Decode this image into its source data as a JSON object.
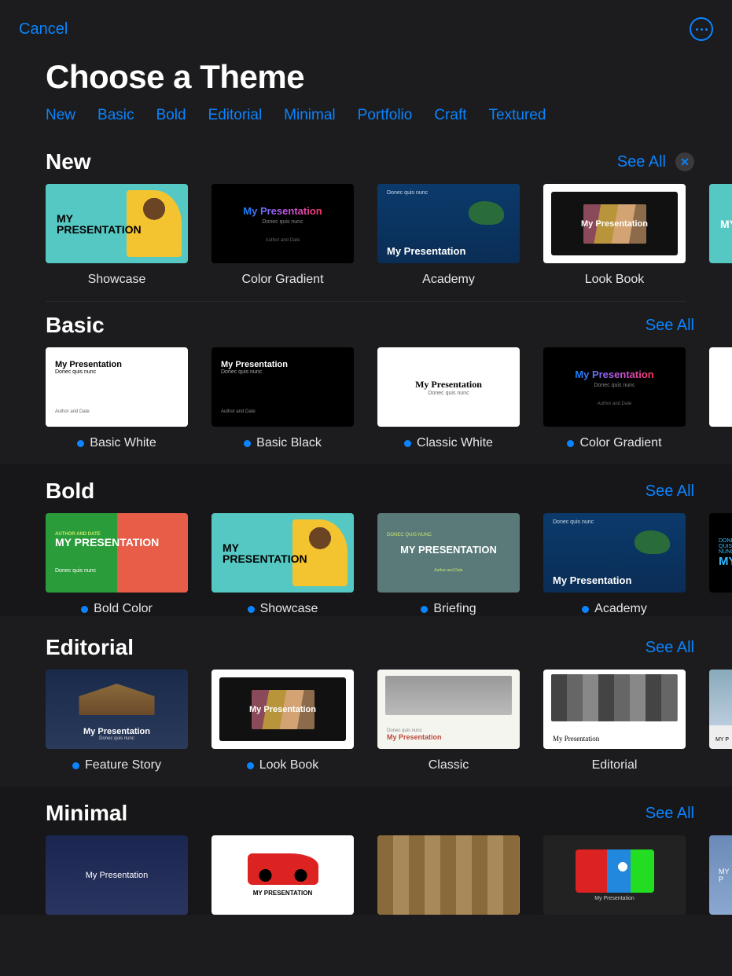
{
  "header": {
    "cancel": "Cancel",
    "title": "Choose a Theme"
  },
  "categories": [
    "New",
    "Basic",
    "Bold",
    "Editorial",
    "Minimal",
    "Portfolio",
    "Craft",
    "Textured"
  ],
  "seeAll": "See All",
  "thumb_text": {
    "my_pres": "My Presentation",
    "my_pres_upper": "MY PRESENTATION",
    "my_pres_split1": "MY",
    "my_pres_split2": "PRESENTATION",
    "donec": "Donec quis nunc",
    "donec_upper": "DONEC QUIS NUNC",
    "author": "Author and Date",
    "author_upper": "AUTHOR AND DATE",
    "my_p": "MY P"
  },
  "sections": [
    {
      "id": "new",
      "title": "New",
      "showClose": true,
      "themes": [
        {
          "label": "Showcase",
          "dot": false
        },
        {
          "label": "Color Gradient",
          "dot": false
        },
        {
          "label": "Academy",
          "dot": false
        },
        {
          "label": "Look Book",
          "dot": false
        }
      ]
    },
    {
      "id": "basic",
      "title": "Basic",
      "showClose": false,
      "themes": [
        {
          "label": "Basic White",
          "dot": true
        },
        {
          "label": "Basic Black",
          "dot": true
        },
        {
          "label": "Classic White",
          "dot": true
        },
        {
          "label": "Color Gradient",
          "dot": true
        }
      ]
    },
    {
      "id": "bold",
      "title": "Bold",
      "showClose": false,
      "themes": [
        {
          "label": "Bold Color",
          "dot": true
        },
        {
          "label": "Showcase",
          "dot": true
        },
        {
          "label": "Briefing",
          "dot": true
        },
        {
          "label": "Academy",
          "dot": true
        }
      ]
    },
    {
      "id": "editorial",
      "title": "Editorial",
      "showClose": false,
      "themes": [
        {
          "label": "Feature Story",
          "dot": true
        },
        {
          "label": "Look Book",
          "dot": true
        },
        {
          "label": "Classic",
          "dot": false
        },
        {
          "label": "Editorial",
          "dot": false
        }
      ]
    },
    {
      "id": "minimal",
      "title": "Minimal",
      "showClose": false,
      "themes": []
    }
  ]
}
